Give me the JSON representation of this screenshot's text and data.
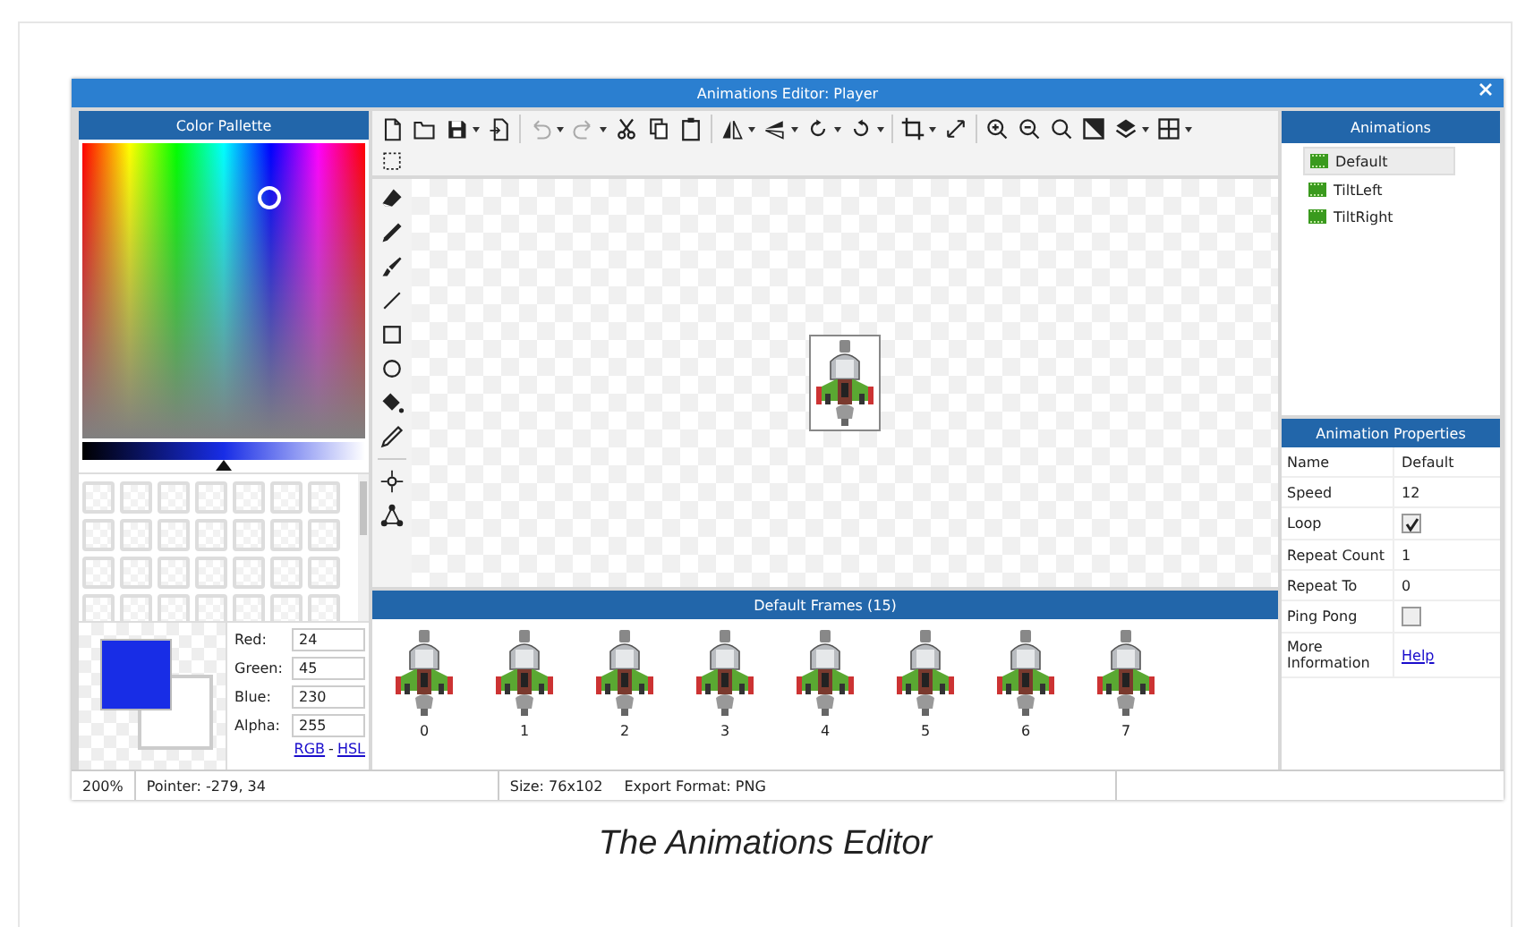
{
  "window": {
    "title": "Animations Editor: Player"
  },
  "toolbar": {
    "undo": {
      "disabled": true
    },
    "redo": {
      "disabled": true
    }
  },
  "color_palette": {
    "title": "Color Pallette",
    "channels": [
      {
        "label": "Red:",
        "value": "24"
      },
      {
        "label": "Green:",
        "value": "45"
      },
      {
        "label": "Blue:",
        "value": "230"
      },
      {
        "label": "Alpha:",
        "value": "255"
      }
    ],
    "brightness_slider": {
      "level": 0.5
    },
    "links": [
      "RGB",
      "HSL"
    ],
    "link_separator": "-"
  },
  "frames": {
    "title": "Default Frames (15)",
    "items": [
      "0",
      "1",
      "2",
      "3",
      "4",
      "5",
      "6",
      "7"
    ]
  },
  "animations": {
    "title": "Animations",
    "items": [
      {
        "label": "Default",
        "selected": true
      },
      {
        "label": "TiltLeft",
        "selected": false
      },
      {
        "label": "TiltRight",
        "selected": false
      }
    ]
  },
  "properties": {
    "title": "Animation Properties",
    "rows": [
      {
        "name": "Name",
        "kind": "text",
        "value": "Default"
      },
      {
        "name": "Speed",
        "kind": "text",
        "value": "12"
      },
      {
        "name": "Loop",
        "kind": "checkbox",
        "checked": true
      },
      {
        "name": "Repeat Count",
        "kind": "text",
        "value": "1"
      },
      {
        "name": "Repeat To",
        "kind": "text",
        "value": "0"
      },
      {
        "name": "Ping Pong",
        "kind": "checkbox",
        "checked": false
      },
      {
        "name": "More Information",
        "kind": "link",
        "value": "Help"
      }
    ]
  },
  "status_bar": {
    "zoom": "200%",
    "pointer": "Pointer: -279, 34",
    "size": "Size: 76x102",
    "export_format": "Export Format: PNG"
  },
  "caption": "The Animations Editor"
}
